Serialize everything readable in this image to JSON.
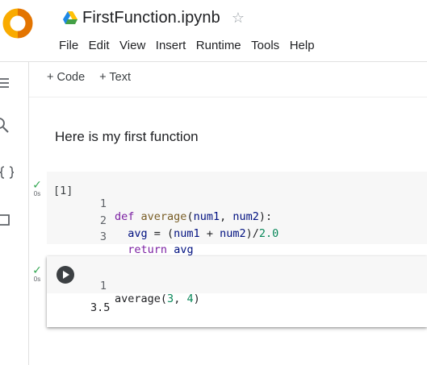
{
  "header": {
    "notebook_title": "FirstFunction.ipynb",
    "star_glyph": "☆",
    "menu": [
      "File",
      "Edit",
      "View",
      "Insert",
      "Runtime",
      "Tools",
      "Help"
    ]
  },
  "toolbar": {
    "add_code_label": "+ Code",
    "add_text_label": "+ Text"
  },
  "sidebar": {
    "icons": [
      "menu-icon",
      "search-icon",
      "code-snippets-icon",
      "files-icon"
    ]
  },
  "cells": {
    "text_cell": "Here is my first function",
    "code_cell_1": {
      "status_check": "✓",
      "exec_time": "0s",
      "exec_count": "[1]",
      "line_numbers": [
        "1",
        "2",
        "3"
      ],
      "tokens": {
        "l1_kw": "def",
        "l1_fn": "average",
        "l1_open": "(",
        "l1_arg1": "num1",
        "l1_comma": ", ",
        "l1_arg2": "num2",
        "l1_close": "):",
        "l2_indent": "  ",
        "l2_var": "avg",
        "l2_expr": " = (",
        "l2_a": "num1",
        "l2_plus": " + ",
        "l2_b": "num2",
        "l2_div": ")/",
        "l2_num": "2.0",
        "l3_indent": "  ",
        "l3_kw": "return",
        "l3_space": " ",
        "l3_var": "avg"
      }
    },
    "code_cell_2": {
      "status_check": "✓",
      "exec_time": "0s",
      "line_number": "1",
      "tokens": {
        "fn": "average",
        "open": "(",
        "n1": "3",
        "comma": ", ",
        "n2": "4",
        "close": ")"
      },
      "output": "3.5"
    }
  },
  "colors": {
    "keyword": "#7b1fa2",
    "function": "#795e26",
    "variable": "#001080",
    "number": "#09885a",
    "success_check": "#34a853",
    "logo_orange": "#f9ab00",
    "logo_orange_dark": "#e37400"
  }
}
